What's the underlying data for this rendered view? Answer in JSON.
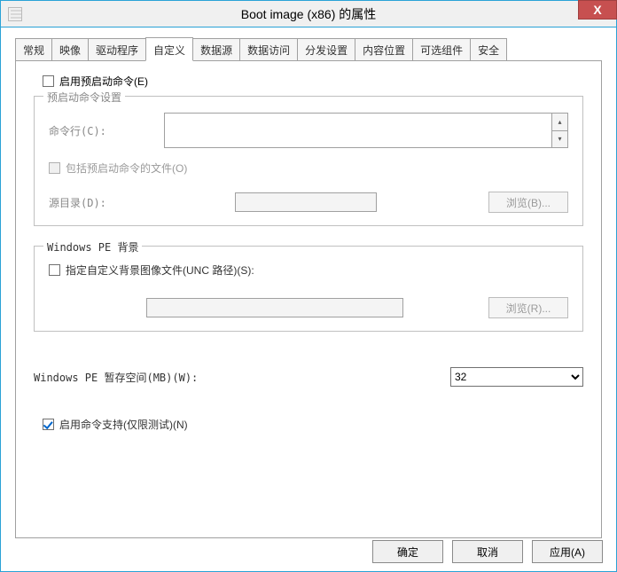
{
  "title": "Boot image (x86) 的属性",
  "close_glyph": "X",
  "tabs": {
    "t0": "常规",
    "t1": "映像",
    "t2": "驱动程序",
    "t3": "自定义",
    "t4": "数据源",
    "t5": "数据访问",
    "t6": "分发设置",
    "t7": "内容位置",
    "t8": "可选组件",
    "t9": "安全"
  },
  "prestart_enable": "启用预启动命令(E)",
  "prestart_group": "预启动命令设置",
  "cmdline_label": "命令行(C):",
  "cmdline_value": "",
  "include_files": "包括预启动命令的文件(O)",
  "srcdir_label": "源目录(D):",
  "srcdir_value": "",
  "browse1": "浏览(B)...",
  "bg_group": "Windows PE 背景",
  "bg_check": "指定自定义背景图像文件(UNC 路径)(S):",
  "bg_value": "",
  "browse2": "浏览(R)...",
  "scratch_label": "Windows PE 暂存空间(MB)(W):",
  "scratch_value": "32",
  "cmd_support": "启用命令支持(仅限测试)(N)",
  "ok": "确定",
  "cancel": "取消",
  "apply": "应用(A)"
}
